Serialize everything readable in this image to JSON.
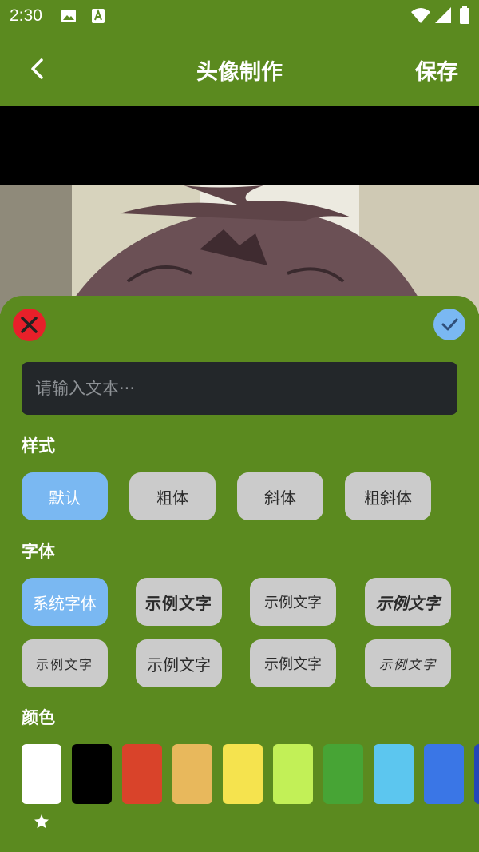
{
  "status_bar": {
    "time": "2:30",
    "icons": [
      "image-icon",
      "app-notification-icon",
      "wifi-icon",
      "signal-icon",
      "battery-icon"
    ]
  },
  "app_bar": {
    "title": "头像制作",
    "save_label": "保存",
    "back_icon": "chevron-left-icon"
  },
  "editor": {
    "close_icon": "close-icon",
    "confirm_icon": "check-icon",
    "text_input": {
      "value": "",
      "placeholder": "请输入文本···"
    },
    "style_section": {
      "label": "样式",
      "options": [
        "默认",
        "粗体",
        "斜体",
        "粗斜体"
      ],
      "selected": "默认"
    },
    "font_section": {
      "label": "字体",
      "options": [
        "系统字体",
        "示例文字",
        "示例文字",
        "示例文字",
        "示例文字",
        "示例文字",
        "示例文字",
        "示例文字"
      ],
      "selected": "系统字体"
    },
    "color_section": {
      "label": "颜色",
      "swatches": [
        "#ffffff",
        "#000000",
        "#d9432a",
        "#e8b85c",
        "#f5e34e",
        "#c2f057",
        "#47a435",
        "#5cc6ef",
        "#3a76e6",
        "#2446b8"
      ],
      "selected_index": 0,
      "selected_marker_icon": "star-icon"
    }
  }
}
